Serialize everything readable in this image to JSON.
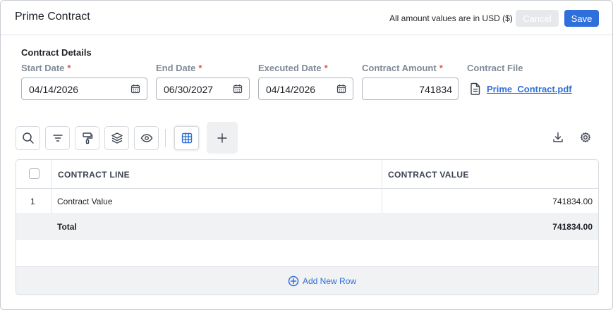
{
  "header": {
    "title": "Prime Contract",
    "currency_note": "All amount values are in USD ($)",
    "cancel_label": "Cancel",
    "save_label": "Save"
  },
  "details": {
    "section_title": "Contract Details",
    "start_date": {
      "label": "Start Date",
      "required": "*",
      "value": "04/14/2026"
    },
    "end_date": {
      "label": "End Date",
      "required": "*",
      "value": "06/30/2027"
    },
    "executed_date": {
      "label": "Executed Date",
      "required": "*",
      "value": "04/14/2026"
    },
    "contract_amount": {
      "label": "Contract Amount",
      "required": "*",
      "value": "741834"
    },
    "contract_file": {
      "label": "Contract File",
      "file_name": "Prime_Contract.pdf"
    }
  },
  "toolbar": {
    "icons": [
      "search-icon",
      "filter-icon",
      "paint-roller-icon",
      "layers-icon",
      "eye-icon",
      "grid-icon",
      "plus-icon",
      "download-icon",
      "gear-icon"
    ]
  },
  "table": {
    "columns": [
      "CONTRACT LINE",
      "CONTRACT VALUE"
    ],
    "rows": [
      {
        "index": "1",
        "line": "Contract Value",
        "value": "741834.00"
      }
    ],
    "total": {
      "label": "Total",
      "value": "741834.00"
    },
    "add_row_label": "Add New Row"
  },
  "colors": {
    "primary": "#2f6fdb",
    "required": "#e0574a",
    "label": "#7f8a96"
  }
}
